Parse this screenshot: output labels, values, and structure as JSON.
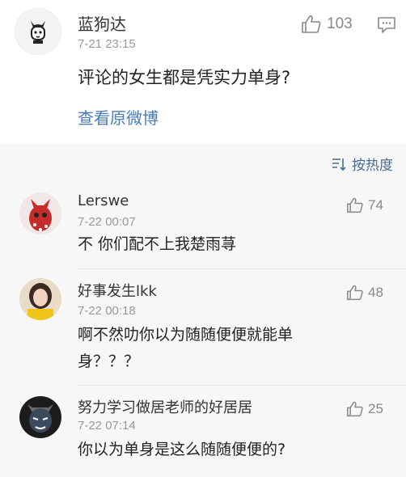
{
  "post": {
    "username": "蓝狗达",
    "time": "7-21 23:15",
    "text": "评论的女生都是凭实力单身?",
    "view_original": "查看原微博",
    "like_count": "103"
  },
  "sort": {
    "label": "按热度"
  },
  "comments": [
    {
      "name": "Lerswe",
      "time": "7-22 00:07",
      "text": "不 你们配不上我楚雨荨",
      "likes": "74"
    },
    {
      "name": "好事发生lkk",
      "time": "7-22 00:18",
      "text": "啊不然叻你以为随随便便就能单身？？？",
      "likes": "48"
    },
    {
      "name": "努力学习做居老师的好居居",
      "time": "7-22 07:14",
      "text": "你以为单身是这么随随便便的?",
      "likes": "25"
    }
  ],
  "colors": {
    "link": "#4a7cb8",
    "sort": "#4a6c94",
    "comments_bg": "#f7f7f7"
  }
}
